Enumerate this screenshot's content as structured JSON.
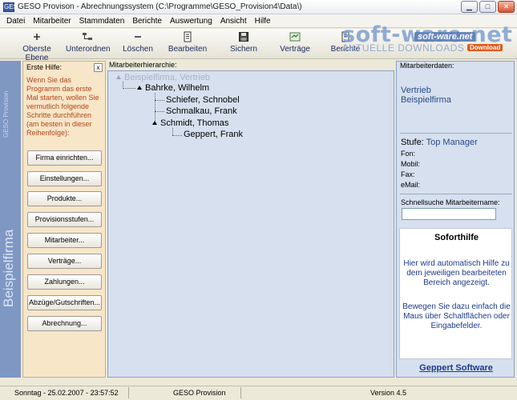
{
  "window": {
    "title": "GESO Provison - Abrechnungssystem (C:\\Programme\\GESO_Provision4\\Data\\)",
    "app_icon": "GESO",
    "controls": [
      "minimize",
      "maximize",
      "close"
    ]
  },
  "menu": [
    "Datei",
    "Mitarbeiter",
    "Stammdaten",
    "Berichte",
    "Auswertung",
    "Ansicht",
    "Hilfe"
  ],
  "toolbar": [
    {
      "label": "Oberste Ebene",
      "icon": "plus-icon"
    },
    {
      "label": "Unterordnen",
      "icon": "hierarchy-icon"
    },
    {
      "label": "Löschen",
      "icon": "minus-icon"
    },
    {
      "label": "Bearbeiten",
      "icon": "edit-icon"
    },
    {
      "label": "Sichern",
      "icon": "save-icon"
    },
    {
      "label": "Verträge",
      "icon": "contract-icon"
    },
    {
      "label": "Berichte",
      "icon": "report-icon"
    }
  ],
  "watermark": {
    "main": "soft-ware.net",
    "overlay": "soft-ware.net",
    "sub": "AKTUELLE DOWNLOADS",
    "badge": "Download"
  },
  "side": {
    "separator_label": "GESO Provision",
    "firm_label": "Beispielfirma"
  },
  "help": {
    "title": "Erste Hilfe:",
    "close": "x",
    "text": "Wenn Sie das Programm das erste Mal starten, wollen Sie vermutlich folgende Schritte durchführen (am besten in dieser Reihenfolge):",
    "buttons": [
      "Firma einrichten...",
      "Einstellungen...",
      "Produkte...",
      "Provisionsstufen...",
      "Mitarbeiter...",
      "Verträge...",
      "Zahlungen...",
      "Abzüge/Gutschriften...",
      "Abrechnung..."
    ]
  },
  "hierarchy": {
    "title": "Mitarbeiterhierarchie:",
    "nodes": [
      "Beispielfirma, Vertrieb",
      "Bahrke, Wilhelm",
      "Schiefer, Schnobel",
      "Schmalkau, Frank",
      "Schmidt, Thomas",
      "Geppert, Frank"
    ]
  },
  "employee": {
    "title": "Mitarbeiterdaten:",
    "company_line1": "Vertrieb",
    "company_line2": "Beispielfirma",
    "stufe_label": "Stufe:",
    "stufe_value": "Top Manager",
    "fon": "Fon:",
    "mobil": "Mobil:",
    "fax": "Fax:",
    "email": "eMail:",
    "search_label": "Schnellsuche Mitarbeitername:",
    "search_value": ""
  },
  "soforthilfe": {
    "title": "Soforthilfe",
    "text1": "Hier wird automatisch Hilfe zu dem jeweiligen bearbeiteten Bereich angezeigt.",
    "text2": "Bewegen Sie dazu einfach die Maus über Schaltflächen oder Eingabefelder."
  },
  "footer_link": "Geppert Software",
  "status": {
    "datetime": "Sonntag - 25.02.2007 - 23:57:52",
    "app": "GESO Provision",
    "version": "Version 4.5"
  }
}
